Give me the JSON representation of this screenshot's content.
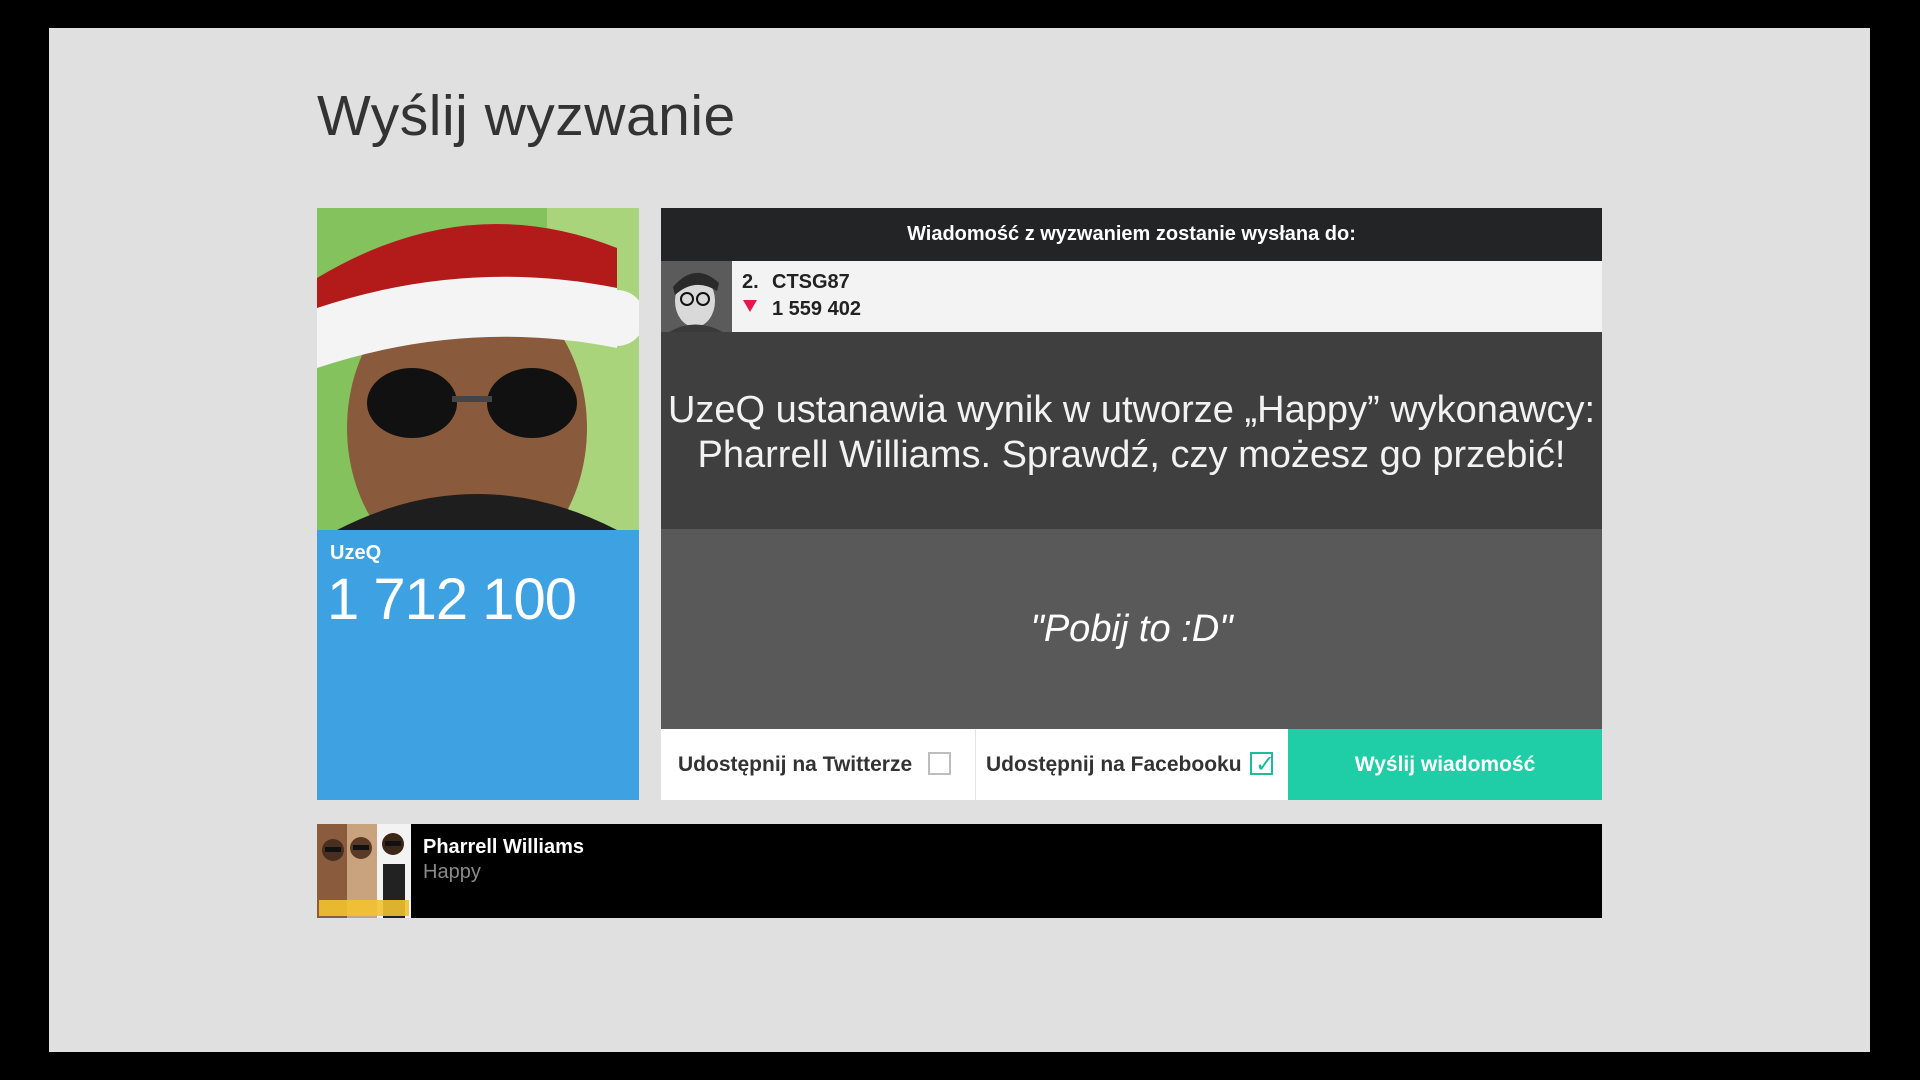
{
  "page": {
    "title": "Wyślij wyzwanie"
  },
  "sender": {
    "name": "UzeQ",
    "score": "1 712 100",
    "avatar_icon": "user-photo"
  },
  "panel": {
    "header": "Wiadomość z wyzwaniem zostanie wysłana do:",
    "recipient": {
      "rank": "2.",
      "name": "CTSG87",
      "score": "1 559 402",
      "trend": "down",
      "trend_color": "#e5174b"
    },
    "challenge_text": "UzeQ ustanawia wynik w utworze „Happy” wykonawcy: Pharrell Williams. Sprawdź, czy możesz go przebić!",
    "quote": "\"Pobij to :D\""
  },
  "actions": {
    "twitter_label": "Udostępnij na Twitterze",
    "twitter_checked": false,
    "facebook_label": "Udostępnij na Facebooku",
    "facebook_checked": true,
    "send_label": "Wyślij wiadomość",
    "accent_color": "#1fcda7"
  },
  "song": {
    "artist": "Pharrell Williams",
    "title": "Happy",
    "album_art_icon": "album-cover"
  }
}
